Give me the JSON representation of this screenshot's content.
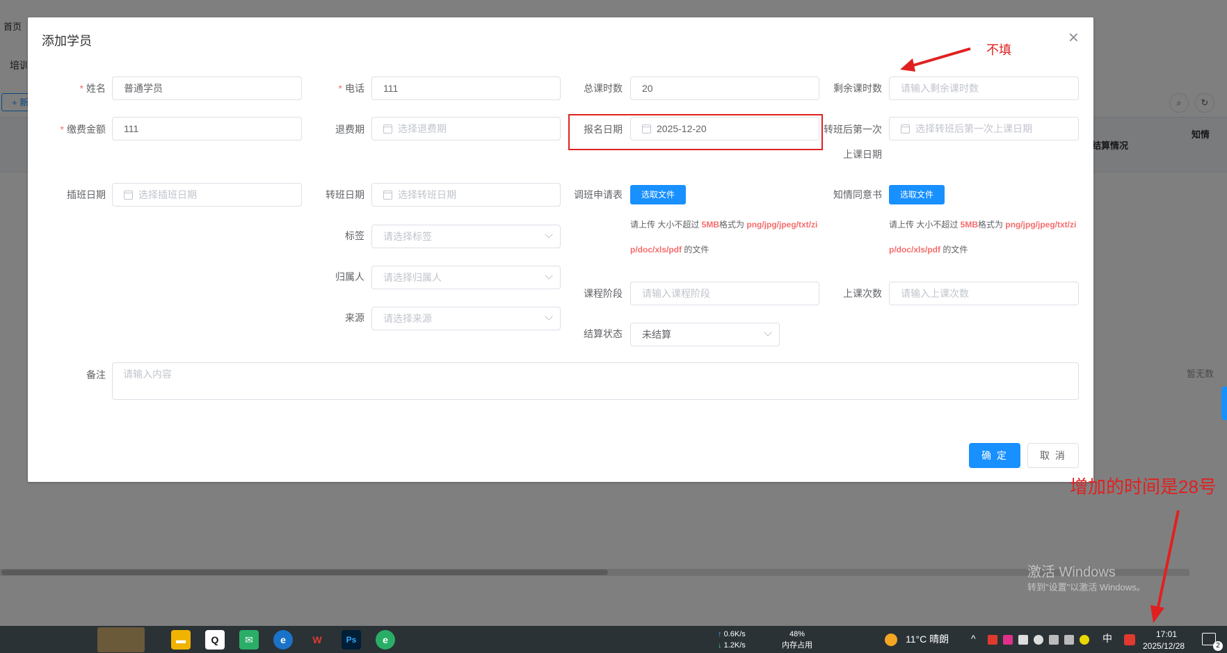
{
  "background": {
    "home_tab": "首页",
    "section_label": "培训",
    "add_button": "+ 新",
    "col_settlement": "结算情况",
    "col_consent": "知情",
    "empty_text": "暂无数"
  },
  "dialog": {
    "title": "添加学员",
    "fields": {
      "name": {
        "label": "姓名",
        "value": "普通学员"
      },
      "phone": {
        "label": "电话",
        "value": "111"
      },
      "total_hours": {
        "label": "总课时数",
        "value": "20"
      },
      "remaining_hours": {
        "label": "剩余课时数",
        "placeholder": "请输入剩余课时数"
      },
      "payment": {
        "label": "缴费金额",
        "value": "111"
      },
      "refund_date": {
        "label": "退费期",
        "placeholder": "选择退费期"
      },
      "signup_date": {
        "label": "报名日期",
        "value": "2025-12-20"
      },
      "first_class_after_transfer": {
        "label_line1": "转班后第一次",
        "label_line2": "上课日期",
        "placeholder": "选择转班后第一次上课日期"
      },
      "insert_date": {
        "label": "插班日期",
        "placeholder": "选择插班日期"
      },
      "transfer_date": {
        "label": "转班日期",
        "placeholder": "选择转班日期"
      },
      "transfer_request": {
        "label": "调班申请表",
        "button": "选取文件"
      },
      "consent_form": {
        "label": "知情同意书",
        "button": "选取文件"
      },
      "tag": {
        "label": "标签",
        "placeholder": "请选择标签"
      },
      "owner": {
        "label": "归属人",
        "placeholder": "请选择归属人"
      },
      "source": {
        "label": "来源",
        "placeholder": "请选择来源"
      },
      "course_stage": {
        "label": "课程阶段",
        "placeholder": "请输入课程阶段"
      },
      "class_count": {
        "label": "上课次数",
        "placeholder": "请输入上课次数"
      },
      "settle_status": {
        "label": "结算状态",
        "value": "未结算"
      },
      "remark": {
        "label": "备注",
        "placeholder": "请输入内容"
      }
    },
    "upload_hint": {
      "prefix": "请上传 大小不超过 ",
      "size": "5MB",
      "mid": "格式为 ",
      "formats_1": "png/jpg/jpeg/txt/zi",
      "formats_2": "p/doc/xls/pdf",
      "suffix": " 的文件"
    },
    "confirm": "确 定",
    "cancel": "取 消"
  },
  "annotations": {
    "not_fill": "不填",
    "added_date": "增加的时间是28号"
  },
  "watermark": {
    "line1": "激活 Windows",
    "line2": "转到\"设置\"以激活 Windows。"
  },
  "taskbar": {
    "net_up": "0.6K/s",
    "net_down": "1.2K/s",
    "mem_percent": "48%",
    "mem_label": "内存占用",
    "weather": "11°C 晴朗",
    "ime": "中",
    "time": "17:01",
    "date": "2025/12/28",
    "notif_count": "2"
  },
  "colors": {
    "primary": "#1890ff",
    "annotation_red": "#e02020",
    "required": "#f56c6c"
  }
}
